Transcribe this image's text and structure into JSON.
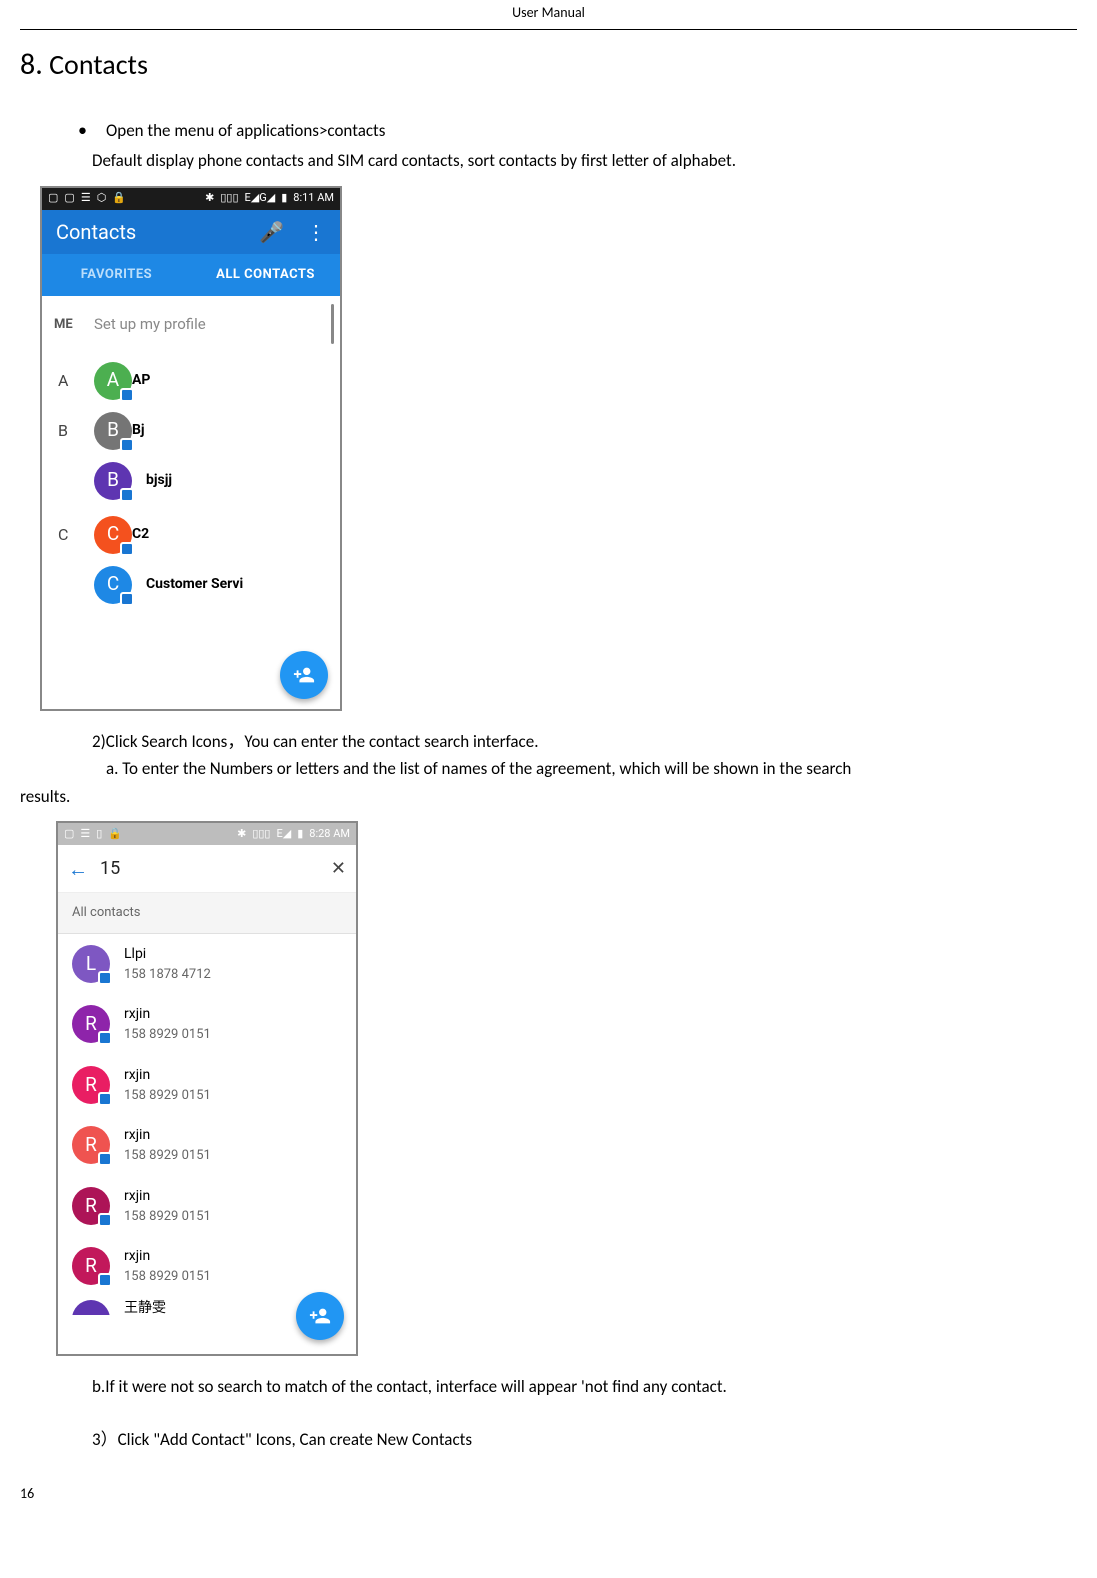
{
  "header": "User   Manual",
  "section": {
    "number": "8.",
    "title": "Contacts"
  },
  "bullets": {
    "b1": "Open the menu of applications>contacts",
    "b1_sub": "Default display phone contacts and SIM card contacts, sort contacts by first letter of alphabet."
  },
  "text": {
    "step2": "2)Click Search Icons，You can enter the contact search interface.",
    "step2a": "a. To enter the Numbers or letters and the list of names of the agreement, which will be shown in the search",
    "step2a_tail": "results.",
    "step2b": "b.If it were not so search to match of the contact, interface will appear 'not find any contact.",
    "step3": "3）Click \"Add Contact\" Icons, Can create New Contacts"
  },
  "shot1": {
    "status_time": "8:11 AM",
    "status_sig": "E◢G◢",
    "app_title": "Contacts",
    "tab_fav": "FAVORITES",
    "tab_all": "ALL CONTACTS",
    "me_label": "ME",
    "me_text": "Set up my profile",
    "groups": [
      {
        "letter": "A",
        "items": [
          {
            "initial": "A",
            "color": "#4caf50",
            "name": "AP"
          }
        ]
      },
      {
        "letter": "B",
        "items": [
          {
            "initial": "B",
            "color": "#757575",
            "name": "Bj"
          },
          {
            "initial": "B",
            "color": "#5e35b1",
            "name": "bjsjj"
          }
        ]
      },
      {
        "letter": "C",
        "items": [
          {
            "initial": "C",
            "color": "#f4511e",
            "name": "C2"
          },
          {
            "initial": "C",
            "color": "#1e88e5",
            "name": "Customer Servi"
          }
        ]
      }
    ]
  },
  "shot2": {
    "status_time": "8:28 AM",
    "status_sig": "E◢",
    "search_query": "15",
    "subhead": "All contacts",
    "results": [
      {
        "initial": "L",
        "color": "#7e57c2",
        "name": "Llpi",
        "phone": "158 1878 4712"
      },
      {
        "initial": "R",
        "color": "#8e24aa",
        "name": "rxjin",
        "phone": "158 8929 0151"
      },
      {
        "initial": "R",
        "color": "#e91e63",
        "name": "rxjin",
        "phone": "158 8929 0151"
      },
      {
        "initial": "R",
        "color": "#ef5350",
        "name": "rxjin",
        "phone": "158 8929 0151"
      },
      {
        "initial": "R",
        "color": "#ad1457",
        "name": "rxjin",
        "phone": "158 8929 0151"
      },
      {
        "initial": "R",
        "color": "#c2185b",
        "name": "rxjin",
        "phone": "158 8929 0151"
      }
    ],
    "cut_row": "王静雯"
  },
  "page_number": "16"
}
